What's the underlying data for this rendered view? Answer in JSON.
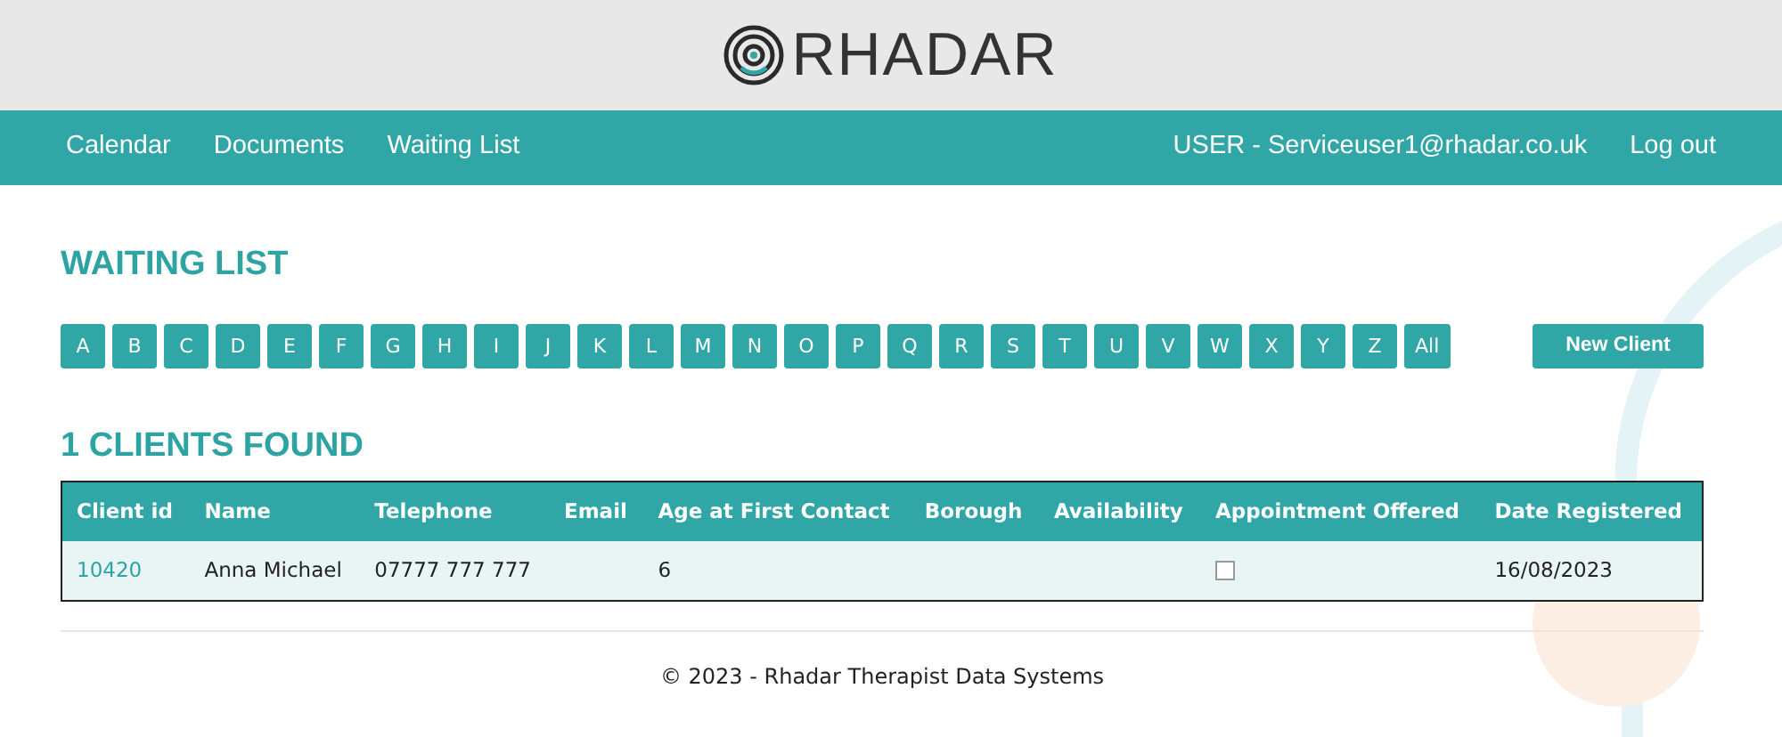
{
  "logo": {
    "text": "RHADAR"
  },
  "nav": {
    "links": [
      {
        "label": "Calendar"
      },
      {
        "label": "Documents"
      },
      {
        "label": "Waiting List"
      }
    ],
    "user": "USER - Serviceuser1@rhadar.co.uk",
    "logout": "Log out"
  },
  "page_title": "WAITING LIST",
  "letters": [
    "A",
    "B",
    "C",
    "D",
    "E",
    "F",
    "G",
    "H",
    "I",
    "J",
    "K",
    "L",
    "M",
    "N",
    "O",
    "P",
    "Q",
    "R",
    "S",
    "T",
    "U",
    "V",
    "W",
    "X",
    "Y",
    "Z",
    "All"
  ],
  "new_client_button": "New Client",
  "results_title": "1 CLIENTS FOUND",
  "table": {
    "columns": [
      "Client id",
      "Name",
      "Telephone",
      "Email",
      "Age at First Contact",
      "Borough",
      "Availability",
      "Appointment Offered",
      "Date Registered"
    ],
    "rows": [
      {
        "client_id": "10420",
        "name": "Anna Michael",
        "telephone": "07777 777 777",
        "age": "6",
        "appointment_offered": false,
        "date_registered": "16/08/2023"
      }
    ]
  },
  "footer": "© 2023 - Rhadar Therapist Data Systems"
}
